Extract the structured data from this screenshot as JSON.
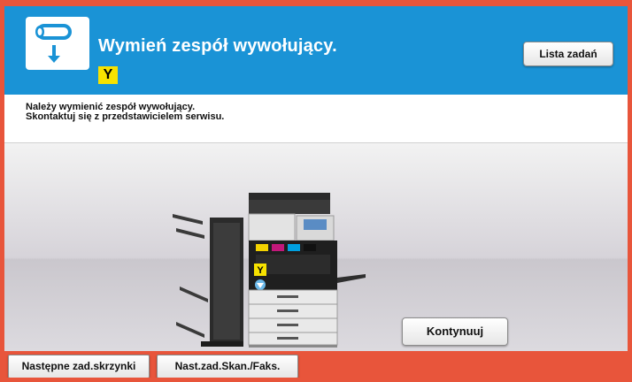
{
  "header": {
    "title": "Wymień zespół wywołujący.",
    "color_badge": "Y",
    "icon": "developing-unit-replace-icon",
    "job_list_label": "Lista zadań"
  },
  "message": {
    "line1": "Należy wymienić zespół wywołujący.",
    "line2": "Skontaktuj się z przedstawicielem serwisu."
  },
  "illustration": {
    "icon": "printer-illustration",
    "indicator_label": "Y"
  },
  "actions": {
    "continue_label": "Kontynuuj"
  },
  "footer": {
    "next_box_job_label": "Następne zad.skrzynki",
    "next_scan_fax_label": "Nast.zad.Skan./Faks."
  },
  "colors": {
    "header_blue": "#1a93d6",
    "frame_orange": "#e8553b",
    "badge_yellow": "#f7e200"
  }
}
